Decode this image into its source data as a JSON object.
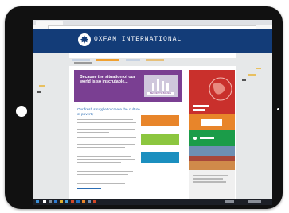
{
  "device": {
    "type": "tablet"
  },
  "browser": {
    "tab_title": "",
    "url": ""
  },
  "site": {
    "logo_text": "OXFAM INTERNATIONAL",
    "tagline": "",
    "nav_items": [
      "",
      "",
      "",
      ""
    ],
    "breadcrumb": ""
  },
  "banner": {
    "text": "Because the situation of our world is so inscrutable...",
    "image_label": "BEHIND THE BRANDS"
  },
  "article": {
    "title": "Our fresh struggle to create the culture of poverty"
  },
  "sidebar": {
    "cta_top": "",
    "photo_caption": ""
  },
  "colors": {
    "header": "#133c78",
    "accent": "#f0a030",
    "banner": "#7a3f92",
    "link": "#2c6eb5",
    "red": "#c9302c",
    "orange": "#e8852a",
    "green": "#1b9c49",
    "blue": "#1b8fbf"
  }
}
